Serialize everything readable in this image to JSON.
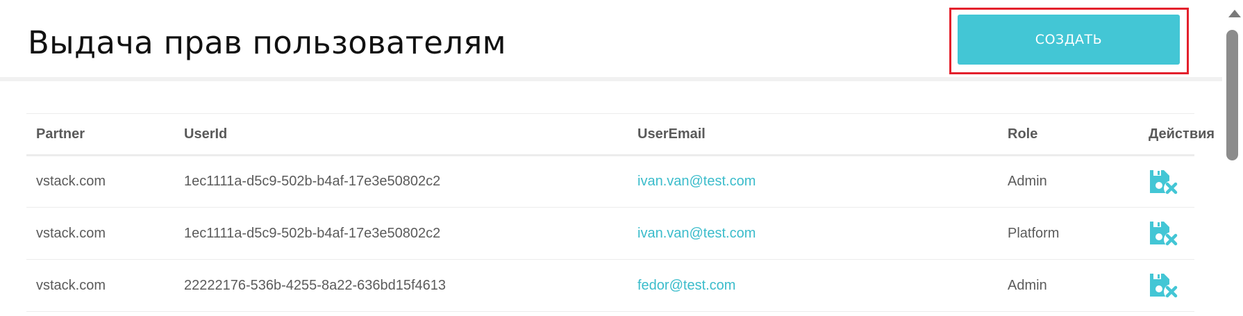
{
  "header": {
    "title": "Выдача прав пользователям",
    "create_label": "СОЗДАТЬ"
  },
  "table": {
    "columns": [
      "Partner",
      "UserId",
      "UserEmail",
      "Role",
      "Действия"
    ],
    "rows": [
      {
        "partner": "vstack.com",
        "user_id": "1ec1111a-d5c9-502b-b4af-17e3e50802c2",
        "email": "ivan.van@test.com",
        "role": "Admin",
        "action_icon": "save-delete-icon"
      },
      {
        "partner": "vstack.com",
        "user_id": "1ec1111a-d5c9-502b-b4af-17e3e50802c2",
        "email": "ivan.van@test.com",
        "role": "Platform",
        "action_icon": "save-delete-icon"
      },
      {
        "partner": "vstack.com",
        "user_id": "22222176-536b-4255-8a22-636bd15f4613",
        "email": "fedor@test.com",
        "role": "Admin",
        "action_icon": "save-delete-icon"
      }
    ]
  },
  "colors": {
    "accent": "#43c6d5",
    "link": "#3bbccb",
    "highlight": "#e3202c"
  }
}
